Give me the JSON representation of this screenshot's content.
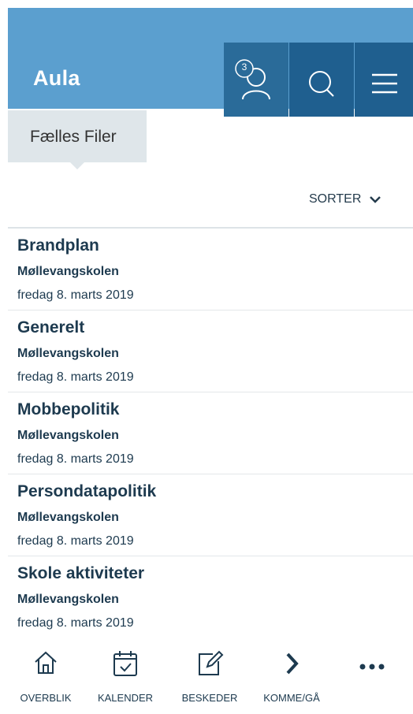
{
  "header": {
    "app_title": "Aula",
    "notification_count": "3",
    "icons": [
      "profile-icon",
      "search-icon",
      "hamburger-menu-icon"
    ],
    "background_color": "#5b9fcf",
    "button_color": "#1f5f8f"
  },
  "tab": {
    "label": "Fælles Filer"
  },
  "sort": {
    "label": "SORTER",
    "icon": "chevron-down-icon"
  },
  "files": [
    {
      "title": "Brandplan",
      "school": "Møllevangskolen",
      "date": "fredag 8. marts 2019"
    },
    {
      "title": "Generelt",
      "school": "Møllevangskolen",
      "date": "fredag 8. marts 2019"
    },
    {
      "title": "Mobbepolitik",
      "school": "Møllevangskolen",
      "date": "fredag 8. marts 2019"
    },
    {
      "title": "Persondatapolitik",
      "school": "Møllevangskolen",
      "date": "fredag 8. marts 2019"
    },
    {
      "title": "Skole aktiviteter",
      "school": "Møllevangskolen",
      "date": "fredag 8. marts 2019"
    }
  ],
  "bottom_nav": [
    {
      "label": "OVERBLIK",
      "icon": "home-icon"
    },
    {
      "label": "KALENDER",
      "icon": "calendar-icon"
    },
    {
      "label": "BESKEDER",
      "icon": "compose-icon"
    },
    {
      "label": "KOMME/GÅ",
      "icon": "chevron-right-icon"
    },
    {
      "label": "",
      "icon": "more-icon"
    }
  ]
}
